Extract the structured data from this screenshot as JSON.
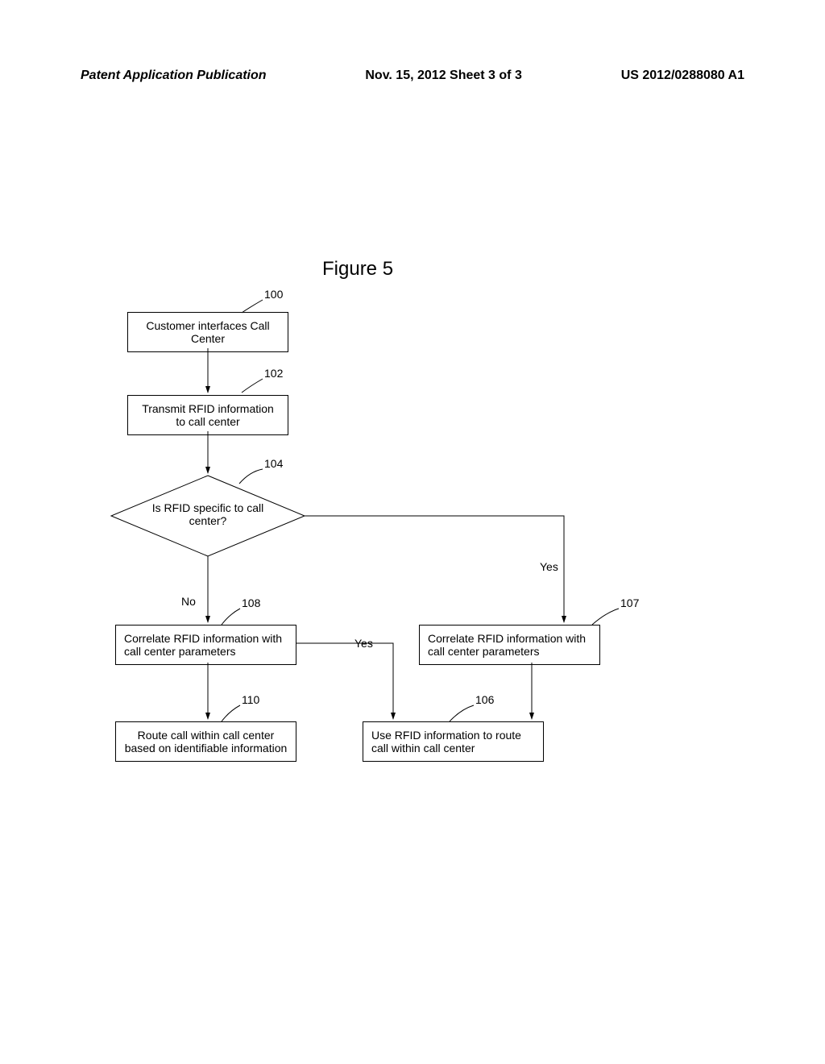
{
  "header": {
    "left": "Patent Application Publication",
    "center": "Nov. 15, 2012  Sheet 3 of 3",
    "right": "US 2012/0288080 A1"
  },
  "figure_title": "Figure 5",
  "boxes": {
    "b100": "Customer interfaces Call Center",
    "b102": "Transmit RFID information to call center",
    "b104": "Is RFID specific to call center?",
    "b108": "Correlate RFID information with call center parameters",
    "b107": "Correlate RFID information with call center parameters",
    "b110": "Route call within call center based on identifiable information",
    "b106": "Use RFID information to route call within call center"
  },
  "refs": {
    "r100": "100",
    "r102": "102",
    "r104": "104",
    "r108": "108",
    "r110": "110",
    "r107": "107",
    "r106": "106"
  },
  "labels": {
    "no": "No",
    "yes1": "Yes",
    "yes2": "Yes"
  },
  "chart_data": {
    "type": "flowchart",
    "title": "Figure 5",
    "nodes": [
      {
        "id": 100,
        "type": "process",
        "text": "Customer interfaces Call Center"
      },
      {
        "id": 102,
        "type": "process",
        "text": "Transmit RFID information to call center"
      },
      {
        "id": 104,
        "type": "decision",
        "text": "Is RFID specific to call center?"
      },
      {
        "id": 108,
        "type": "process",
        "text": "Correlate RFID information with call center parameters"
      },
      {
        "id": 107,
        "type": "process",
        "text": "Correlate RFID information with call center parameters"
      },
      {
        "id": 110,
        "type": "process",
        "text": "Route call within call center based on identifiable information"
      },
      {
        "id": 106,
        "type": "process",
        "text": "Use RFID information to route call within call center"
      }
    ],
    "edges": [
      {
        "from": 100,
        "to": 102,
        "label": ""
      },
      {
        "from": 102,
        "to": 104,
        "label": ""
      },
      {
        "from": 104,
        "to": 108,
        "label": "No"
      },
      {
        "from": 104,
        "to": 107,
        "label": "Yes"
      },
      {
        "from": 108,
        "to": 110,
        "label": ""
      },
      {
        "from": 108,
        "to": 106,
        "label": "Yes"
      },
      {
        "from": 107,
        "to": 106,
        "label": ""
      }
    ]
  }
}
